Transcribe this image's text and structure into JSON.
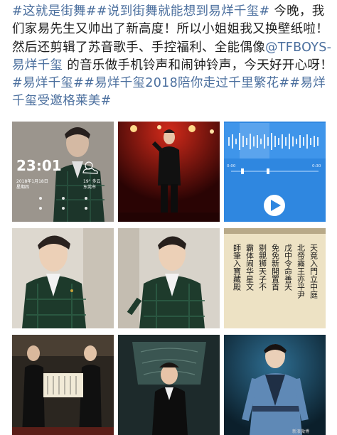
{
  "post": {
    "line1_hashtag": "#这就是街舞##说到街舞就能想到易烊千玺#",
    "line1_text": " 今晚，我们家易先生又帅出了新高度！所以小姐姐我又换壁纸啦！然后还剪辑了苏音歌手、手控福利、全能偶像",
    "mention": "@TFBOYS-易烊千玺",
    "middle_text": "的音乐做手机铃声和闹钟铃声，今天好开心呀！",
    "trailing_hashtags": "#易烊千玺##易烊千玺2018陪你走过千里繁花##易烊千玺受邀格莱美#"
  },
  "lockscreen": {
    "time": "23:01",
    "date": "2018年1月18日",
    "weekday": "星期四",
    "weather": "19° 多云",
    "city": "东莞市"
  },
  "player": {
    "time_start": "0:00",
    "time_end": "0:30"
  },
  "calligraphy": {
    "col1": "天竟入門立中庭",
    "col2": "北帝霧王亦平尹",
    "col3": "戊中令命善天",
    "col4": "免免新開置首",
    "col5": "剔親狮天子不",
    "col6": "霸体闹华星文",
    "col7": "師筆入寶藏殿"
  },
  "watermark": "新浪微博"
}
